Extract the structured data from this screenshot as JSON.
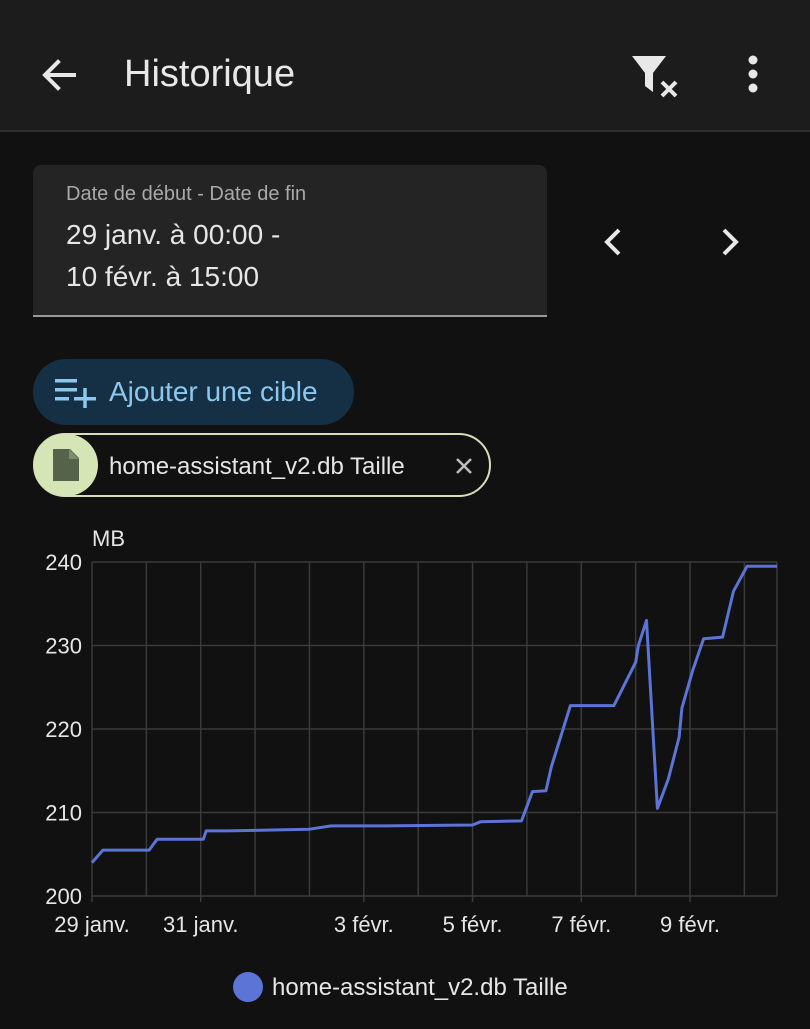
{
  "header": {
    "title": "Historique",
    "back_icon": "arrow-left-icon",
    "filter_icon": "filter-remove-icon",
    "menu_icon": "dots-vertical-icon"
  },
  "date_range": {
    "label": "Date de début - Date de fin",
    "line1": "29 janv. à 00:00 -",
    "line2": "10 févr. à 15:00",
    "prev_icon": "chevron-left-icon",
    "next_icon": "chevron-right-icon"
  },
  "add_target": {
    "label": "Ajouter une cible",
    "icon": "playlist-plus-icon",
    "color": "#8cc8ee"
  },
  "target_chip": {
    "label": "home-assistant_v2.db Taille",
    "icon": "file-icon",
    "close_icon": "close-icon"
  },
  "chart_data": {
    "type": "line",
    "unit_label": "MB",
    "y_ticks": [
      200,
      210,
      220,
      230,
      240
    ],
    "ylim": [
      200,
      240
    ],
    "x_tick_labels": [
      "29 janv.",
      "31 janv.",
      "3 févr.",
      "5 févr.",
      "7 févr.",
      "9 févr."
    ],
    "x_tick_days": [
      0,
      2,
      5,
      7,
      9,
      11
    ],
    "xlim_days": [
      0,
      12.6
    ],
    "x_start": "29 janv.",
    "grid": true,
    "legend_position": "bottom",
    "series": [
      {
        "name": "home-assistant_v2.db Taille",
        "color": "#5b74d6",
        "x_days": [
          0,
          0.2,
          0.25,
          1.05,
          1.2,
          1.9,
          2.05,
          2.1,
          2.5,
          4.0,
          4.4,
          5.4,
          7.0,
          7.15,
          7.9,
          8.1,
          8.35,
          8.45,
          8.8,
          9.6,
          10.0,
          10.05,
          10.2,
          10.4,
          10.6,
          10.8,
          10.85,
          11.05,
          11.25,
          11.6,
          11.8,
          12.05,
          12.6
        ],
        "y_values": [
          204,
          205.5,
          205.5,
          205.5,
          206.8,
          206.8,
          206.8,
          207.8,
          207.8,
          208,
          208.4,
          208.4,
          208.5,
          208.9,
          209,
          212.5,
          212.6,
          215.5,
          222.8,
          222.8,
          228,
          230,
          233,
          210.5,
          214,
          219,
          222.5,
          227,
          230.8,
          231,
          236.5,
          239.5,
          239.5
        ]
      }
    ]
  }
}
